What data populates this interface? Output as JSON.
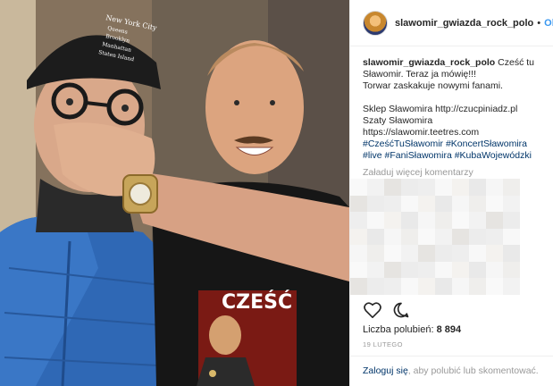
{
  "post": {
    "header": {
      "username": "slawomir_gwiazda_rock_polo",
      "separator": "•",
      "follow_label": "Obser"
    },
    "caption": {
      "username": "slawomir_gwiazda_rock_polo",
      "lines": [
        "Cześć tu",
        "Sławomir. Teraz ja mówię!!!",
        "Torwar zaskakuje nowymi fanami.",
        "",
        "Sklep Sławomira http://czucpiniadz.pl",
        "Szaty Sławomira",
        "https://slawomir.teetres.com"
      ],
      "hashtags": [
        "#CześćTuSławomir #KoncertSławomira",
        "#live #FaniSławomira #KubaWojewódzki"
      ]
    },
    "load_more_comments": "Załaduj więcej komentarzy",
    "likes_label": "Liczba polubień:",
    "likes_count": "8 894",
    "date": "19 LUTEGO",
    "footer": {
      "login_link": "Zaloguj się",
      "rest": ", aby polubić lub skomentować."
    },
    "icons": {
      "like": "heart-icon",
      "comment": "comment-icon",
      "avatar": "avatar"
    },
    "photo": {
      "cap_text": [
        "New York City",
        "Queens",
        "Brooklyn",
        "Manhattan",
        "Staten Island"
      ],
      "shirt_text": "CZEŚĆ"
    },
    "colors": {
      "accent": "#3897f0",
      "link": "#003569",
      "muted": "#999999"
    }
  }
}
